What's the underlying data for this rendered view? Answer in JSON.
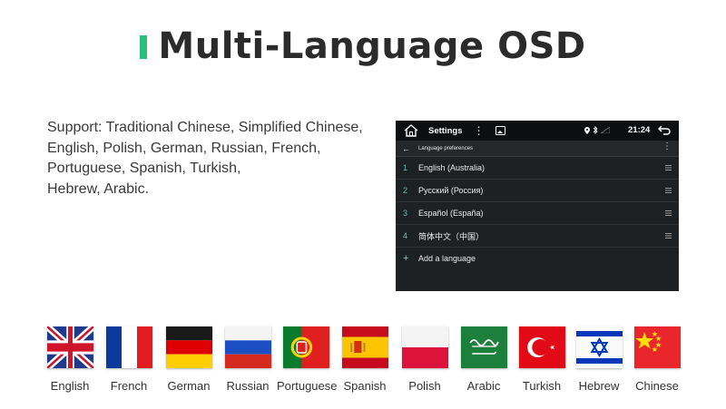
{
  "header": {
    "title": "Multi-Language OSD",
    "accent_color": "#2bbf7e"
  },
  "support": {
    "lines": [
      "Support: Traditional Chinese, Simplified Chinese,",
      "English, Polish, German, Russian, French,",
      "Portuguese, Spanish, Turkish,",
      "Hebrew, Arabic."
    ]
  },
  "screen": {
    "status": {
      "title": "Settings",
      "time": "21:24"
    },
    "sub": {
      "title": "Language preferences"
    },
    "languages": [
      {
        "num": "1",
        "name": "English (Australia)"
      },
      {
        "num": "2",
        "name": "Русский (Россия)"
      },
      {
        "num": "3",
        "name": "Español (España)"
      },
      {
        "num": "4",
        "name": "简体中文（中国）"
      }
    ],
    "add_label": "Add a language"
  },
  "flags": [
    {
      "label": "English",
      "icon": "uk-flag-icon"
    },
    {
      "label": "French",
      "icon": "france-flag-icon"
    },
    {
      "label": "German",
      "icon": "germany-flag-icon"
    },
    {
      "label": "Russian",
      "icon": "russia-flag-icon"
    },
    {
      "label": "Portuguese",
      "icon": "portugal-flag-icon"
    },
    {
      "label": "Spanish",
      "icon": "spain-flag-icon"
    },
    {
      "label": "Polish",
      "icon": "poland-flag-icon"
    },
    {
      "label": "Arabic",
      "icon": "saudi-arabia-flag-icon"
    },
    {
      "label": "Turkish",
      "icon": "turkey-flag-icon"
    },
    {
      "label": "Hebrew",
      "icon": "israel-flag-icon"
    },
    {
      "label": "Chinese",
      "icon": "china-flag-icon"
    }
  ]
}
